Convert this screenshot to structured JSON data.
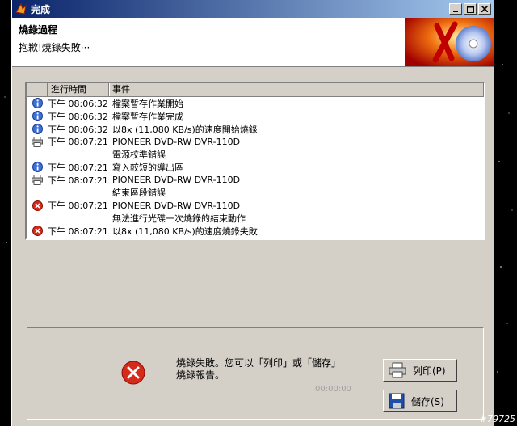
{
  "window": {
    "title": "完成"
  },
  "header": {
    "title": "燒錄過程",
    "subtitle": "抱歉!燒錄失敗···"
  },
  "log": {
    "columns": [
      "進行時間",
      "事件"
    ],
    "rows": [
      {
        "icon": "info-icon",
        "time": "下午 08:06:32",
        "event": "檔案暫存作業開始"
      },
      {
        "icon": "info-icon",
        "time": "下午 08:06:32",
        "event": "檔案暫存作業完成"
      },
      {
        "icon": "info-icon",
        "time": "下午 08:06:32",
        "event": "以8x (11,080 KB/s)的速度開始燒錄"
      },
      {
        "icon": "printer-icon",
        "time": "下午 08:07:21",
        "event": "PIONEER  DVD-RW  DVR-110D"
      },
      {
        "icon": "",
        "time": "",
        "event": "電源校準錯誤"
      },
      {
        "icon": "info-icon",
        "time": "下午 08:07:21",
        "event": "寫入較短的導出區"
      },
      {
        "icon": "printer-icon",
        "time": "下午 08:07:21",
        "event": "PIONEER  DVD-RW  DVR-110D"
      },
      {
        "icon": "",
        "time": "",
        "event": "結束區段錯誤"
      },
      {
        "icon": "error-icon",
        "time": "下午 08:07:21",
        "event": "PIONEER  DVD-RW  DVR-110D"
      },
      {
        "icon": "",
        "time": "",
        "event": "無法進行光碟一次燒錄的結束動作"
      },
      {
        "icon": "error-icon",
        "time": "下午 08:07:21",
        "event": "以8x (11,080 KB/s)的速度燒錄失敗"
      }
    ]
  },
  "footer": {
    "message": "燒錄失敗。您可以「列印」或「儲存」燒錄報告。",
    "timer": "00:00:00",
    "print_label": "列印(P)",
    "save_label": "儲存(S)"
  },
  "watermark": "#79725"
}
